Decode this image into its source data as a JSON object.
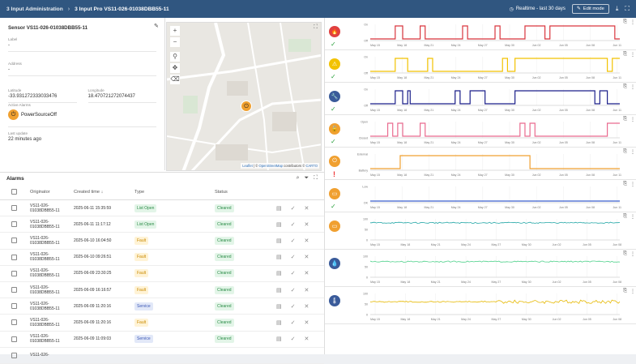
{
  "breadcrumb": {
    "parent": "3 Input Administration",
    "current": "3 Input Pro VS11-026-01038DBB55-11"
  },
  "toolbar": {
    "realtime": "Realtime - last 30 days",
    "edit": "Edit mode"
  },
  "sensor": {
    "title": "Sensor VS11-026-01038DBB55-11",
    "label_label": "Label",
    "label_value": "-",
    "address_label": "Address",
    "address_value": "-",
    "lat_label": "Latitude",
    "lat_value": "-33.931272333033476",
    "lng_label": "Longitude",
    "lng_value": "18.470721272074437",
    "active_label": "Active Alarms",
    "active_value": "PowerSourceOff",
    "update_label": "Last update",
    "update_value": "22 minutes ago"
  },
  "map": {
    "attr_leaflet": "Leaflet",
    "attr_osm": "OpenStreetMap",
    "attr_mid": " contributors © ",
    "attr_carto": "CARTO"
  },
  "alarms": {
    "title": "Alarms",
    "headers": {
      "originator": "Originator",
      "created": "Created time ↓",
      "type": "Type",
      "status": "Status"
    },
    "rows": [
      {
        "orig1": "VS11-026-",
        "orig2": "01038DBB55-11",
        "time": "2025-06-11 15:35:59",
        "type": "List Open",
        "status": "Cleared"
      },
      {
        "orig1": "VS11-026-",
        "orig2": "01038DBB55-11",
        "time": "2025-06-11 11:17:12",
        "type": "List Open",
        "status": "Cleared"
      },
      {
        "orig1": "VS11-026-",
        "orig2": "01038DBB55-11",
        "time": "2025-06-10 16:04:50",
        "type": "Fault",
        "status": "Cleared"
      },
      {
        "orig1": "VS11-026-",
        "orig2": "01038DBB55-11",
        "time": "2025-06-10 09:26:51",
        "type": "Fault",
        "status": "Cleared"
      },
      {
        "orig1": "VS11-026-",
        "orig2": "01038DBB55-11",
        "time": "2025-06-09 23:30:25",
        "type": "Fault",
        "status": "Cleared"
      },
      {
        "orig1": "VS11-026-",
        "orig2": "01038DBB55-11",
        "time": "2025-06-09 16:16:57",
        "type": "Fault",
        "status": "Cleared"
      },
      {
        "orig1": "VS11-026-",
        "orig2": "01038DBB55-11",
        "time": "2025-06-09 11:20:16",
        "type": "Service",
        "status": "Cleared"
      },
      {
        "orig1": "VS11-026-",
        "orig2": "01038DBB55-11",
        "time": "2025-06-09 11:20:16",
        "type": "Fault",
        "status": "Cleared"
      },
      {
        "orig1": "VS11-026-",
        "orig2": "01038DBB55-11",
        "time": "2025-06-09 11:09:03",
        "type": "Service",
        "status": "Cleared"
      },
      {
        "orig1": "VS11-026-",
        "orig2": "",
        "time": "",
        "type": "",
        "status": ""
      }
    ]
  },
  "chart_data": [
    {
      "type": "line",
      "step": true,
      "color": "#d9363e",
      "y_labels": [
        "On",
        "Off"
      ],
      "x": [
        "May 15",
        "May 18",
        "May 21",
        "May 24",
        "May 27",
        "May 30",
        "Jun 02",
        "Jun 05",
        "Jun 08",
        "Jun 11"
      ]
    },
    {
      "type": "line",
      "step": true,
      "color": "#f2c200",
      "y_labels": [
        "On",
        "Off"
      ],
      "x": [
        "May 15",
        "May 18",
        "May 21",
        "May 24",
        "May 27",
        "May 30",
        "Jun 02",
        "Jun 05",
        "Jun 08",
        "Jun 11"
      ]
    },
    {
      "type": "line",
      "step": true,
      "color": "#1b1f8a",
      "y_labels": [
        "On",
        "Off"
      ],
      "x": [
        "May 15",
        "May 18",
        "May 21",
        "May 24",
        "May 27",
        "May 30",
        "Jun 02",
        "Jun 05",
        "Jun 08",
        "Jun 11"
      ]
    },
    {
      "type": "line",
      "step": true,
      "color": "#e96b8f",
      "y_labels": [
        "Open",
        "Closed"
      ],
      "x": [
        "May 15",
        "May 18",
        "May 21",
        "May 24",
        "May 27",
        "May 30",
        "Jun 02",
        "Jun 05",
        "Jun 08",
        "Jun 11"
      ]
    },
    {
      "type": "line",
      "step": true,
      "color": "#f0a030",
      "y_labels": [
        "External",
        "Battery"
      ],
      "x": [
        "May 15",
        "May 18",
        "May 21",
        "May 24",
        "May 27",
        "May 30",
        "Jun 02",
        "Jun 05",
        "Jun 08",
        "Jun 11"
      ]
    },
    {
      "type": "line",
      "step": true,
      "color": "#3a5fcd",
      "y_labels": [
        "Low",
        "OK"
      ],
      "x": [
        "May 15",
        "May 18",
        "May 21",
        "May 24",
        "May 27",
        "May 30",
        "Jun 02",
        "Jun 05",
        "Jun 08",
        "Jun 11"
      ]
    },
    {
      "type": "line",
      "color": "#22a6a6",
      "y_labels": [
        "100",
        "50",
        "0"
      ],
      "x": [
        "May 15",
        "May 18",
        "May 21",
        "May 24",
        "May 27",
        "May 30",
        "Jun 02",
        "Jun 05",
        "Jun 08"
      ]
    },
    {
      "type": "line",
      "color": "#4fd18b",
      "y_labels": [
        "100",
        "50",
        "0"
      ],
      "x": [
        "May 15",
        "May 18",
        "May 21",
        "May 24",
        "May 27",
        "May 30",
        "Jun 02",
        "Jun 05",
        "Jun 08"
      ]
    },
    {
      "type": "line",
      "color": "#e6b800",
      "y_labels": [
        "100",
        "50",
        "0"
      ],
      "x": [
        "May 15",
        "May 18",
        "May 21",
        "May 24",
        "May 27",
        "May 30",
        "Jun 02",
        "Jun 05",
        "Jun 08"
      ]
    }
  ],
  "panels": [
    {
      "icon_bg": "#e04040",
      "icon": "flame-icon",
      "glyph": "🔥",
      "state": "check"
    },
    {
      "icon_bg": "#f2c200",
      "icon": "warning-icon",
      "glyph": "⚠",
      "state": "check"
    },
    {
      "icon_bg": "#3a5b9a",
      "icon": "wrench-icon",
      "glyph": "🔧",
      "state": "check"
    },
    {
      "icon_bg": "#f0a030",
      "icon": "lock-icon",
      "glyph": "🔓",
      "state": "check"
    },
    {
      "icon_bg": "#f0a030",
      "icon": "plug-icon",
      "glyph": "⏻",
      "state": "alert"
    },
    {
      "icon_bg": "#f0a030",
      "icon": "battery-icon",
      "glyph": "▭",
      "state": "check"
    },
    {
      "icon_bg": "#f0a030",
      "icon": "battery-level-icon",
      "glyph": "▭",
      "state": "none"
    },
    {
      "icon_bg": "#3a5b9a",
      "icon": "drop-icon",
      "glyph": "💧",
      "state": "none"
    },
    {
      "icon_bg": "#3a5b9a",
      "icon": "thermometer-icon",
      "glyph": "🌡",
      "state": "none"
    }
  ]
}
